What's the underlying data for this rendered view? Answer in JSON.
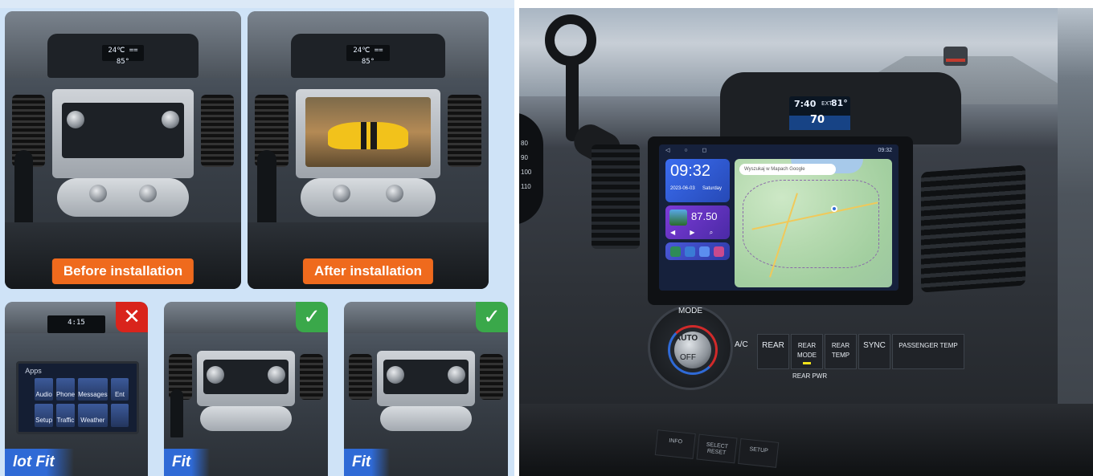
{
  "left": {
    "before_label": "Before installation",
    "after_label": "After installation",
    "dash_display": "24℃ == 85°",
    "bad_fit_badge": "✕",
    "good_fit_badge": "✓",
    "bad_fit_label": "lot Fit",
    "fit_label_1": "Fit",
    "fit_label_2": "Fit",
    "bad_unit": {
      "title": "Apps",
      "tiles": [
        "Audio",
        "Phone",
        "Messages",
        "Ent",
        "Setup",
        "Traffic",
        "Weather",
        ""
      ]
    }
  },
  "right": {
    "info_display": {
      "time": "7:40",
      "ext_label": "EXT",
      "temp": "81°",
      "bottom": "70"
    },
    "speedo_ticks": [
      "80",
      "90",
      "100",
      "110"
    ],
    "head_unit": {
      "clock": "09:32",
      "date": "2023-06-03",
      "weekday": "Saturday",
      "status_time": "09:32",
      "radio_freq": "87.50",
      "search_placeholder": "Wyszukaj w Mapach Google",
      "nav_glyphs": "◁ ○ ◻"
    },
    "climate": {
      "mode": "MODE",
      "auto": "AUTO",
      "off": "OFF",
      "ac": "A/C",
      "rear": "REAR",
      "rear_mode": "REAR MODE",
      "rear_pwr": "REAR PWR",
      "rear_temp": "REAR TEMP",
      "sync": "SYNC",
      "passenger_temp": "PASSENGER TEMP"
    },
    "bottom_keys": [
      "INFO",
      "SELECT RESET",
      "SETUP"
    ]
  },
  "colors": {
    "accent_orange": "#ef6a1d",
    "bad_red": "#d9241c",
    "good_green": "#3aa84a",
    "fit_blue": "#2f6ad6"
  }
}
